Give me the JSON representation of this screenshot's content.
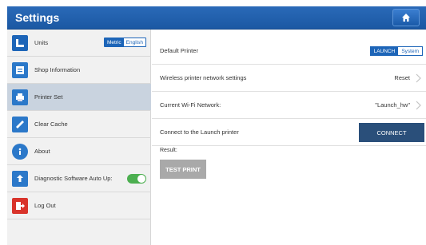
{
  "header": {
    "title": "Settings",
    "home_icon": "home-icon"
  },
  "colors": {
    "title_bar": "#1f5fae",
    "accent": "#1d65b8",
    "active_item": "#c9d3df",
    "connect_button": "#2a4f7a",
    "switch_on": "#4caf50"
  },
  "sidebar": {
    "items": [
      {
        "label": "Units",
        "icon": "ruler-icon"
      },
      {
        "label": "Shop Information",
        "icon": "shop-info-icon"
      },
      {
        "label": "Printer Set",
        "icon": "printer-icon"
      },
      {
        "label": "Clear Cache",
        "icon": "broom-icon"
      },
      {
        "label": "About",
        "icon": "info-icon"
      },
      {
        "label": "Diagnostic Software Auto Up:",
        "icon": "upload-icon"
      },
      {
        "label": "Log Out",
        "icon": "logout-icon"
      }
    ],
    "active_item": "Printer Set",
    "units_toggle": {
      "options": [
        "Metric",
        "English"
      ],
      "selected": "Metric"
    },
    "auto_update_switch": "on"
  },
  "main": {
    "default_printer": {
      "label": "Default Printer",
      "options": [
        "LAUNCH",
        "System"
      ],
      "selected": "LAUNCH"
    },
    "wireless_settings": {
      "label": "Wireless printer network settings",
      "value": "Reset"
    },
    "current_wifi": {
      "label": "Current Wi-Fi Network:",
      "value": "\"Launch_hw\""
    },
    "connect": {
      "label": "Connect to the Launch printer",
      "button": "CONNECT"
    },
    "result_label": "Result:",
    "test_print_button": "TEST PRINT"
  }
}
